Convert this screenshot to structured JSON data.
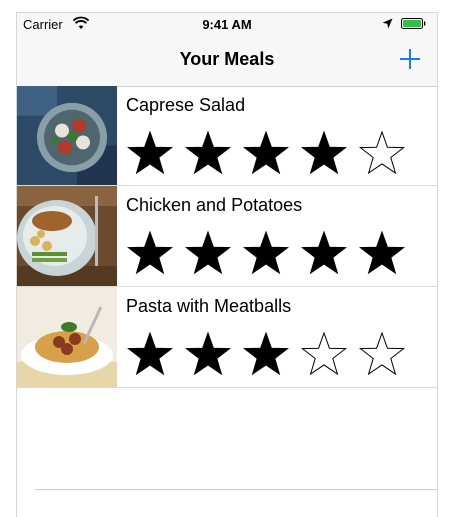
{
  "statusbar": {
    "carrier": "Carrier",
    "time": "9:41 AM"
  },
  "navbar": {
    "title": "Your Meals",
    "add_icon": "plus-icon"
  },
  "accent_color": "#1a7cf5",
  "meals": [
    {
      "name": "Caprese Salad",
      "rating": 4,
      "max_rating": 5
    },
    {
      "name": "Chicken and Potatoes",
      "rating": 5,
      "max_rating": 5
    },
    {
      "name": "Pasta with Meatballs",
      "rating": 3,
      "max_rating": 5
    }
  ]
}
